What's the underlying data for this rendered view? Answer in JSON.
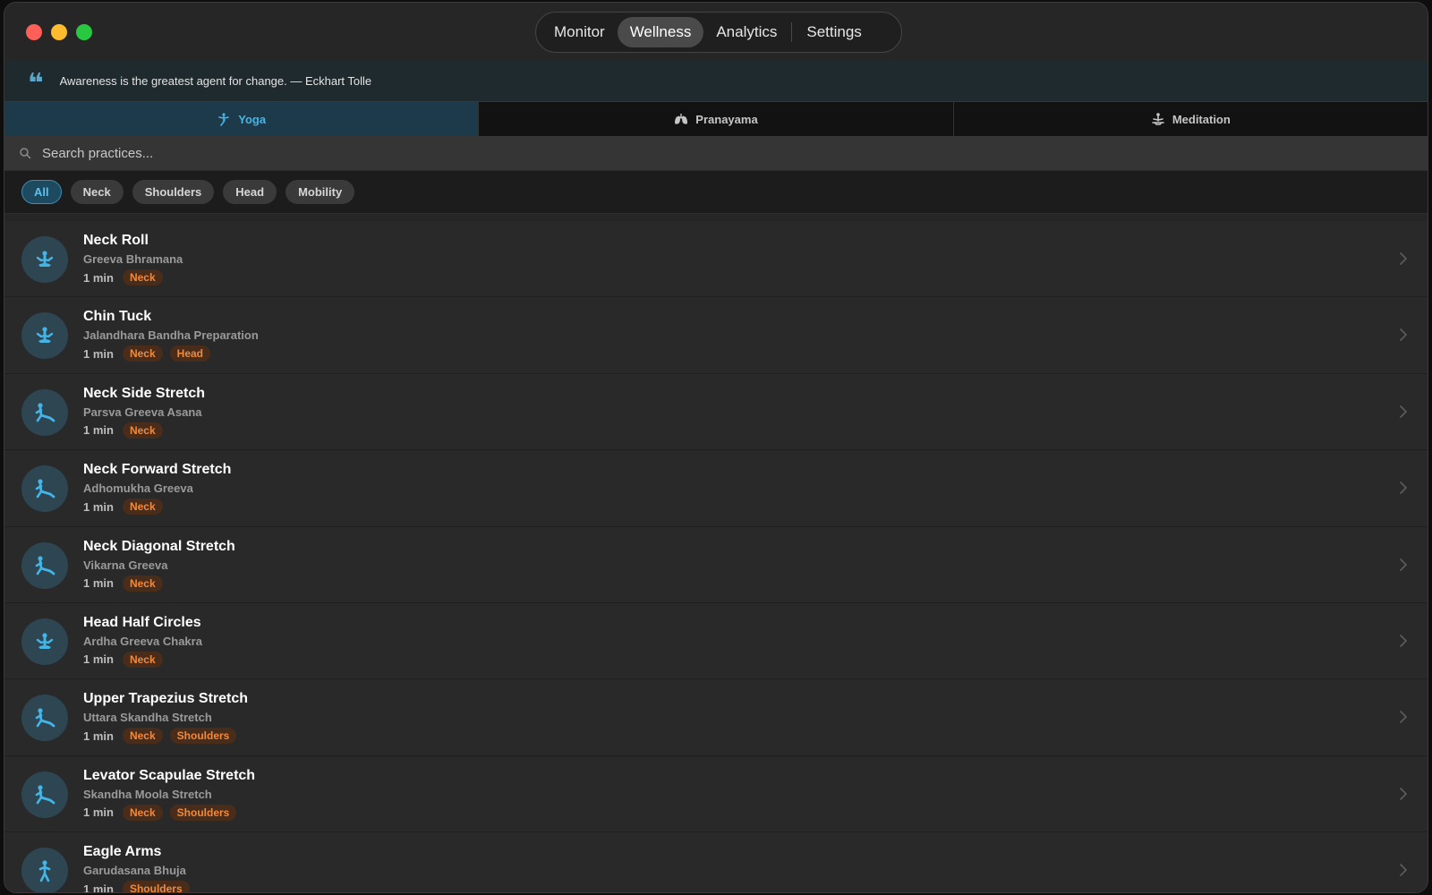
{
  "nav": {
    "items": [
      {
        "label": "Monitor",
        "active": false
      },
      {
        "label": "Wellness",
        "active": true
      },
      {
        "label": "Analytics",
        "active": false
      },
      {
        "label": "Settings",
        "active": false
      }
    ]
  },
  "quote": {
    "text": "Awareness is the greatest agent for change. — Eckhart Tolle"
  },
  "practice_tabs": [
    {
      "label": "Yoga",
      "icon": "yoga-icon",
      "active": true
    },
    {
      "label": "Pranayama",
      "icon": "lungs-icon",
      "active": false
    },
    {
      "label": "Meditation",
      "icon": "meditation-icon",
      "active": false
    }
  ],
  "search": {
    "placeholder": "Search practices..."
  },
  "filters": [
    {
      "label": "All",
      "active": true
    },
    {
      "label": "Neck",
      "active": false
    },
    {
      "label": "Shoulders",
      "active": false
    },
    {
      "label": "Head",
      "active": false
    },
    {
      "label": "Mobility",
      "active": false
    }
  ],
  "practices": [
    {
      "title": "Neck Roll",
      "subtitle": "Greeva Bhramana",
      "duration": "1 min",
      "tags": [
        "Neck"
      ],
      "icon": "seated-pose-icon"
    },
    {
      "title": "Chin Tuck",
      "subtitle": "Jalandhara Bandha Preparation",
      "duration": "1 min",
      "tags": [
        "Neck",
        "Head"
      ],
      "icon": "seated-pose-icon"
    },
    {
      "title": "Neck Side Stretch",
      "subtitle": "Parsva Greeva Asana",
      "duration": "1 min",
      "tags": [
        "Neck"
      ],
      "icon": "stretch-pose-icon"
    },
    {
      "title": "Neck Forward Stretch",
      "subtitle": "Adhomukha Greeva",
      "duration": "1 min",
      "tags": [
        "Neck"
      ],
      "icon": "stretch-pose-icon"
    },
    {
      "title": "Neck Diagonal Stretch",
      "subtitle": "Vikarna Greeva",
      "duration": "1 min",
      "tags": [
        "Neck"
      ],
      "icon": "stretch-pose-icon"
    },
    {
      "title": "Head Half Circles",
      "subtitle": "Ardha Greeva Chakra",
      "duration": "1 min",
      "tags": [
        "Neck"
      ],
      "icon": "seated-pose-icon"
    },
    {
      "title": "Upper Trapezius Stretch",
      "subtitle": "Uttara Skandha Stretch",
      "duration": "1 min",
      "tags": [
        "Neck",
        "Shoulders"
      ],
      "icon": "stretch-pose-icon"
    },
    {
      "title": "Levator Scapulae Stretch",
      "subtitle": "Skandha Moola Stretch",
      "duration": "1 min",
      "tags": [
        "Neck",
        "Shoulders"
      ],
      "icon": "stretch-pose-icon"
    },
    {
      "title": "Eagle Arms",
      "subtitle": "Garudasana Bhuja",
      "duration": "1 min",
      "tags": [
        "Shoulders"
      ],
      "icon": "standing-pose-icon"
    }
  ],
  "colors": {
    "accent": "#45b4e6",
    "tag_text": "#f08a3a",
    "tag_bg": "#4a2c1a"
  }
}
